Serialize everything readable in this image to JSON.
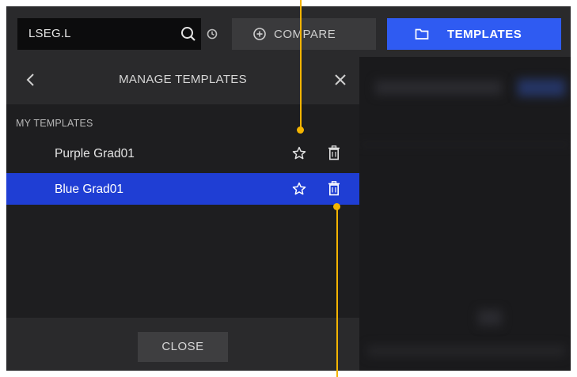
{
  "toolbar": {
    "search_value": "LSEG.L",
    "compare_label": "COMPARE",
    "templates_label": "TEMPLATES",
    "icons": [
      "search-icon",
      "history-icon",
      "plus-circle-icon",
      "folder-icon"
    ],
    "accent_color": "#2f5bf2"
  },
  "panel": {
    "title": "MANAGE TEMPLATES",
    "section_label": "MY TEMPLATES",
    "templates": [
      {
        "name": "Purple Grad01",
        "selected": false
      },
      {
        "name": "Blue Grad01",
        "selected": true
      }
    ],
    "close_label": "CLOSE",
    "selected_color": "#1f3ed4",
    "icons": [
      "back-chevron-icon",
      "close-icon",
      "star-icon",
      "trash-icon"
    ]
  },
  "annotations": {
    "callout_color": "#f4b400"
  }
}
